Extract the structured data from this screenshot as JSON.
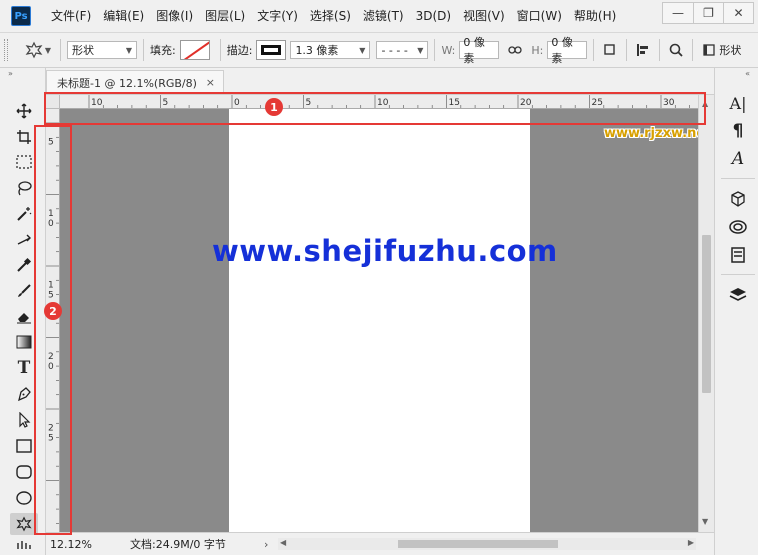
{
  "app": {
    "logo_text": "Ps"
  },
  "menu": [
    "文件(F)",
    "编辑(E)",
    "图像(I)",
    "图层(L)",
    "文字(Y)",
    "选择(S)",
    "滤镜(T)",
    "3D(D)",
    "视图(V)",
    "窗口(W)",
    "帮助(H)"
  ],
  "window_controls": {
    "minimize": "—",
    "maximize": "❐",
    "close": "✕"
  },
  "options_bar": {
    "mode_value": "形状",
    "fill_label": "填充:",
    "stroke_label": "描边:",
    "stroke_width_value": "1.3 像素",
    "stroke_type_value": "- - - -",
    "width_label": "W:",
    "width_value": "0 像素",
    "height_label": "H:",
    "height_value": "0 像素",
    "shape_text": "形状",
    "fill_color": "none",
    "stroke_color": "#111111"
  },
  "document": {
    "tab_title": "未标题-1 @ 12.1%(RGB/8)",
    "tab_close": "×"
  },
  "ruler_h_labels": [
    "10",
    "5",
    "0",
    "5",
    "10",
    "15",
    "20",
    "25",
    "30"
  ],
  "ruler_v_labels": [
    "5",
    "1\n0",
    "1\n5",
    "2\n0",
    "2\n5"
  ],
  "status": {
    "zoom": "12.12%",
    "doc_info": "文档:24.9M/0 字节",
    "arrow": "›"
  },
  "watermarks": {
    "main": "www.shejifuzhu.com",
    "corner": "www.rjzxw.net"
  },
  "annotations": {
    "badge1": "1",
    "badge2": "2",
    "color": "#e53935"
  },
  "toolbox_icons": [
    "move-icon",
    "artboard-icon",
    "marquee-icon",
    "lasso-icon",
    "magic-wand-icon",
    "crop-icon",
    "eyedropper-icon",
    "brush-icon",
    "eraser-icon",
    "gradient-icon",
    "type-icon",
    "pen-icon",
    "path-select-icon",
    "rectangle-icon",
    "rounded-rect-icon",
    "ellipse-icon",
    "custom-shape-icon"
  ],
  "right_dock_icons": [
    "character-icon",
    "paragraph-icon",
    "glyphs-icon",
    "3d-icon",
    "libraries-icon",
    "properties-icon",
    "layers-icon"
  ]
}
